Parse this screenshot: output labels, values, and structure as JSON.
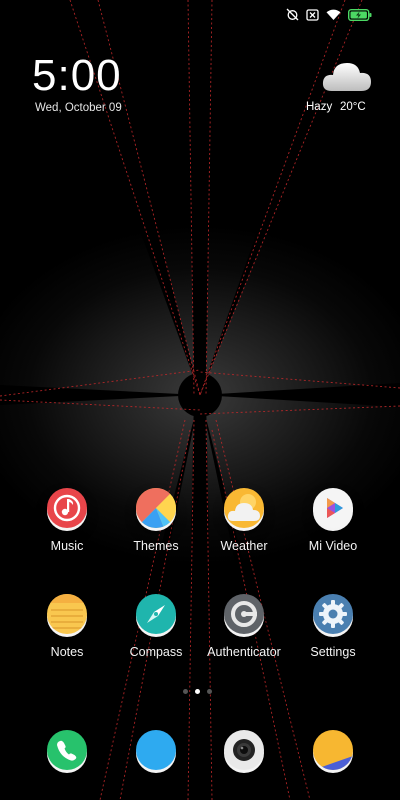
{
  "status_bar": {
    "icons": [
      "alarm-off-icon",
      "no-sim-icon",
      "wifi-icon",
      "battery-charging-icon"
    ],
    "accent": "#4cd964"
  },
  "lock_widget": {
    "time": "5:00",
    "date": "Wed, October 09"
  },
  "weather": {
    "icon": "cloud-icon",
    "condition": "Hazy",
    "temperature": "20°C"
  },
  "apps": [
    {
      "label": "Music",
      "icon": "music-icon"
    },
    {
      "label": "Themes",
      "icon": "themes-icon"
    },
    {
      "label": "Weather",
      "icon": "weather-icon"
    },
    {
      "label": "Mi Video",
      "icon": "mi-video-icon"
    },
    {
      "label": "Notes",
      "icon": "notes-icon"
    },
    {
      "label": "Compass",
      "icon": "compass-icon"
    },
    {
      "label": "Authenticator",
      "icon": "authenticator-icon"
    },
    {
      "label": "Settings",
      "icon": "settings-icon"
    }
  ],
  "page_indicator": {
    "pages": 3,
    "current": 2
  },
  "dock": [
    {
      "icon": "phone-icon"
    },
    {
      "icon": "messaging-icon"
    },
    {
      "icon": "camera-icon"
    },
    {
      "icon": "gallery-icon"
    }
  ]
}
